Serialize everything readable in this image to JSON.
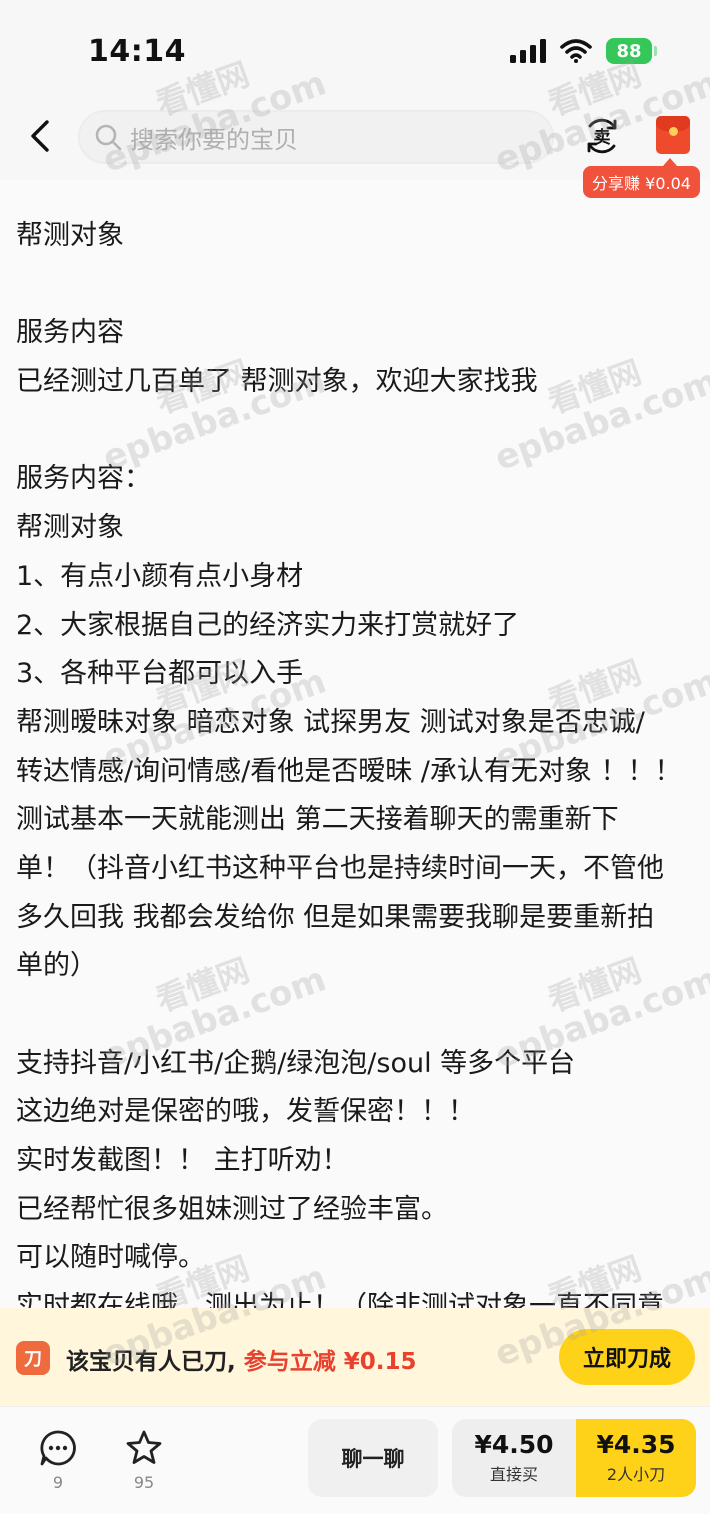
{
  "status_bar": {
    "time": "14:14",
    "battery": "88"
  },
  "header": {
    "search_placeholder": "搜索你要的宝贝",
    "sell_label": "卖",
    "share_badge": "分享赚 ¥0.04"
  },
  "description": {
    "lines": [
      "帮测对象",
      "",
      "服务内容",
      "已经测过几百单了  帮测对象，欢迎大家找我",
      "",
      "服务内容：",
      "帮测对象",
      "1、有点小颜有点小身材",
      "2、大家根据自己的经济实力来打赏就好了",
      "3、各种平台都可以入手",
      "帮测暧昧对象 暗恋对象 试探男友 测试对象是否忠诚/",
      "转达情感/询问情感/看他是否暧昧 /承认有无对象 ！！！",
      "测试基本一天就能测出 第二天接着聊天的需重新下",
      "单！（抖音小红书这种平台也是持续时间一天，不管他",
      "多久回我 我都会发给你 但是如果需要我聊是要重新拍",
      "单的）",
      "",
      "支持抖音/小红书/企鹅/绿泡泡/soul 等多个平台",
      "这边绝对是保密的哦，发誓保密！！！",
      "实时发截图！！ 主打听劝！",
      "已经帮忙很多姐妹测过了经验丰富。",
      "可以随时喊停。",
      "实时都在线哦，测出为止！（除非测试对象一直不同意"
    ]
  },
  "watermark": {
    "cn": "看懂网",
    "en": "epbaba.com"
  },
  "bargain": {
    "icon_label": "刀",
    "text": "该宝贝有人已刀,",
    "accent": "参与立减 ¥0.15",
    "button": "立即刀成"
  },
  "bottom": {
    "comment_count": "9",
    "favorite_count": "95",
    "chat_label": "聊一聊",
    "direct_price": "¥4.50",
    "direct_label": "直接买",
    "bargain_price": "¥4.35",
    "bargain_label": "2人小刀"
  },
  "colors": {
    "accent_yellow": "#ffd21a",
    "accent_red": "#e8422f",
    "battery_green": "#35c759"
  }
}
